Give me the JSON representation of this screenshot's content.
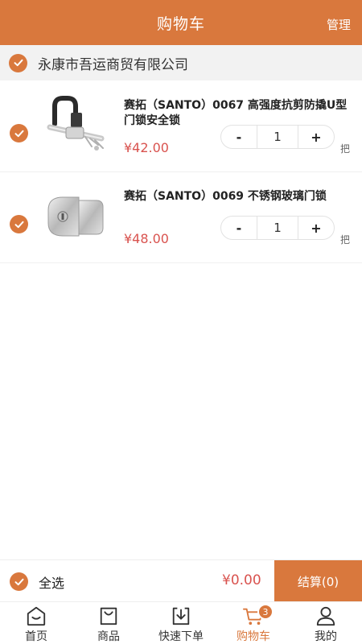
{
  "header": {
    "title": "购物车",
    "manage_label": "管理"
  },
  "store": {
    "name": "永康市吾运商贸有限公司"
  },
  "items": [
    {
      "name": "赛拓（SANTO）0067 高强度抗剪防撬U型门锁安全锁",
      "price": "¥42.00",
      "quantity": "1",
      "unit": "把",
      "minus": "-",
      "plus": "+"
    },
    {
      "name": "赛拓（SANTO）0069 不锈钢玻璃门锁",
      "price": "¥48.00",
      "quantity": "1",
      "unit": "把",
      "minus": "-",
      "plus": "+"
    }
  ],
  "footer": {
    "select_all_label": "全选",
    "total": "¥0.00",
    "checkout_label": "结算(0)"
  },
  "tabbar": {
    "tabs": [
      {
        "label": "首页",
        "icon": "home-icon"
      },
      {
        "label": "商品",
        "icon": "bag-icon"
      },
      {
        "label": "快速下单",
        "icon": "download-box-icon"
      },
      {
        "label": "购物车",
        "icon": "cart-icon",
        "badge": "3",
        "active": true
      },
      {
        "label": "我的",
        "icon": "user-icon"
      }
    ]
  },
  "colors": {
    "accent": "#d9783d",
    "price": "#d9534f"
  }
}
